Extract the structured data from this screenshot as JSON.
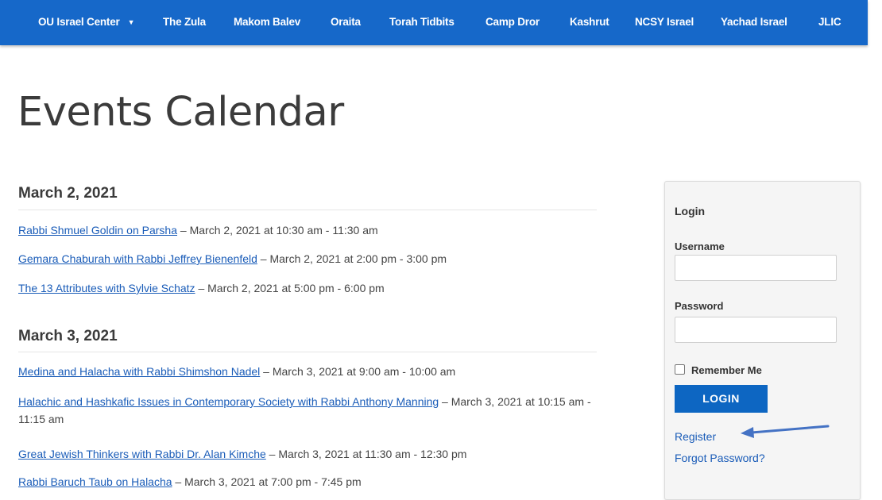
{
  "nav": {
    "items": [
      {
        "label": "OU Israel Center"
      },
      {
        "label": "The Zula"
      },
      {
        "label": "Makom Balev"
      },
      {
        "label": "Oraita"
      },
      {
        "label": "Torah Tidbits"
      },
      {
        "label": "Camp Dror"
      },
      {
        "label": "Kashrut"
      },
      {
        "label": "NCSY Israel"
      },
      {
        "label": "Yachad Israel"
      },
      {
        "label": "JLIC"
      }
    ],
    "dropdown_caret": "▼"
  },
  "page": {
    "title": "Events Calendar"
  },
  "days": [
    {
      "date": "March 2, 2021",
      "events": [
        {
          "title": "Rabbi Shmuel Goldin on Parsha",
          "time": " – March 2, 2021 at 10:30 am - 11:30 am"
        },
        {
          "title": "Gemara Chaburah with Rabbi Jeffrey Bienenfeld",
          "time": " – March 2, 2021 at 2:00 pm - 3:00 pm"
        },
        {
          "title": "The 13 Attributes with Sylvie Schatz",
          "time": " – March 2, 2021 at 5:00 pm - 6:00 pm"
        }
      ]
    },
    {
      "date": "March 3, 2021",
      "events": [
        {
          "title": "Medina and Halacha with Rabbi Shimshon Nadel",
          "time": " – March 3, 2021 at 9:00 am - 10:00 am"
        },
        {
          "title": "Halachic and Hashkafic Issues in Contemporary Society with Rabbi Anthony Manning",
          "time": " – March 3, 2021 at 10:15 am - 11:15 am"
        },
        {
          "title": "Great Jewish Thinkers with Rabbi Dr. Alan Kimche",
          "time": " – March 3, 2021 at 11:30 am - 12:30 pm"
        },
        {
          "title": "Rabbi Baruch Taub on Halacha",
          "time": " – March 3, 2021 at 7:00 pm - 7:45 pm"
        }
      ]
    }
  ],
  "login": {
    "title": "Login",
    "username_label": "Username",
    "username_value": "",
    "password_label": "Password",
    "password_value": "",
    "remember_label": "Remember Me",
    "remember_checked": false,
    "button_label": "LOGIN",
    "register_label": "Register",
    "forgot_label": "Forgot Password?"
  },
  "colors": {
    "nav_bg": "#1668c9",
    "link": "#1a5cb8",
    "login_button": "#0d66c2",
    "annotation_arrow": "#4472c4"
  }
}
